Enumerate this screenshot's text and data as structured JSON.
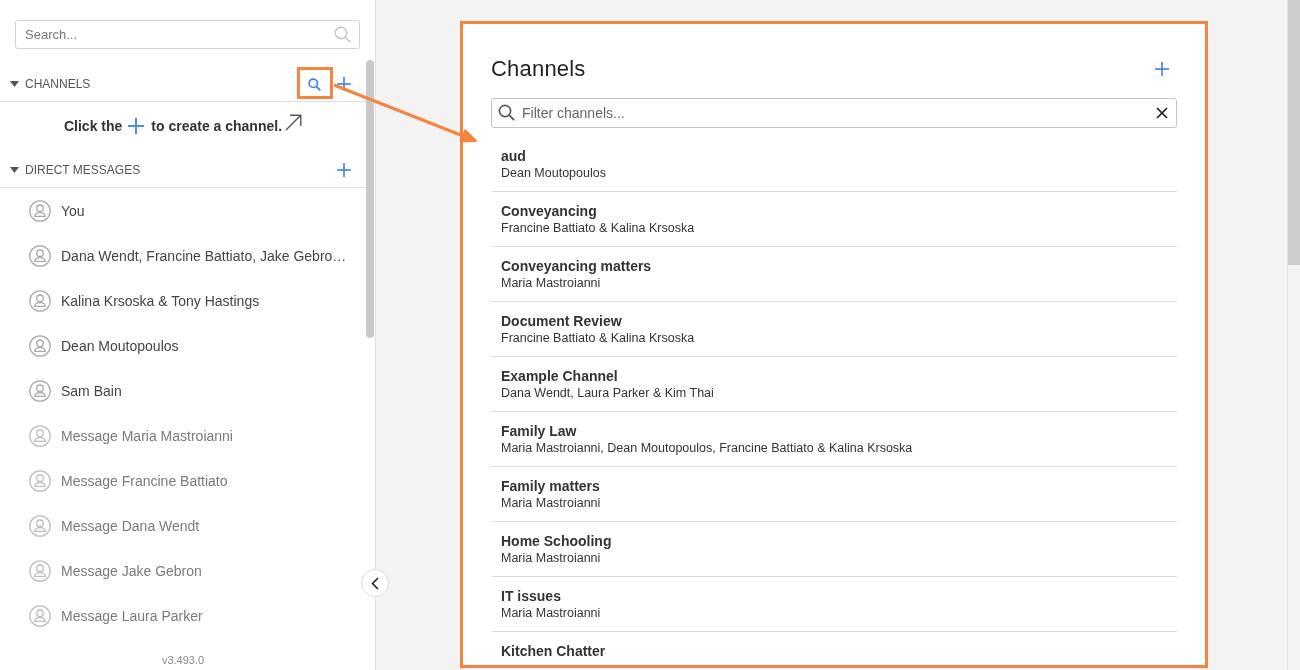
{
  "sidebar": {
    "search": {
      "placeholder": "Search..."
    },
    "channels": {
      "title": "CHANNELS",
      "expanded": true,
      "hint_before": "Click the",
      "hint_after": "to create a channel."
    },
    "direct_messages": {
      "title": "DIRECT MESSAGES",
      "expanded": true,
      "items": [
        {
          "label": "You",
          "kind": "conversation"
        },
        {
          "label": "Dana Wendt, Francine Battiato, Jake Gebro…",
          "kind": "conversation"
        },
        {
          "label": "Kalina Krsoska & Tony Hastings",
          "kind": "conversation"
        },
        {
          "label": "Dean Moutopoulos",
          "kind": "conversation"
        },
        {
          "label": "Sam Bain",
          "kind": "conversation"
        },
        {
          "label": "Message Maria Mastroianni",
          "kind": "suggestion"
        },
        {
          "label": "Message Francine Battiato",
          "kind": "suggestion"
        },
        {
          "label": "Message Dana Wendt",
          "kind": "suggestion"
        },
        {
          "label": "Message Jake Gebron",
          "kind": "suggestion"
        },
        {
          "label": "Message Laura Parker",
          "kind": "suggestion"
        }
      ]
    },
    "version": "v3.493.0"
  },
  "channels_panel": {
    "title": "Channels",
    "filter": {
      "placeholder": "Filter channels..."
    },
    "channels": [
      {
        "name": "aud",
        "members": "Dean Moutopoulos"
      },
      {
        "name": "Conveyancing",
        "members": "Francine Battiato & Kalina Krsoska"
      },
      {
        "name": "Conveyancing matters",
        "members": "Maria Mastroianni"
      },
      {
        "name": "Document Review",
        "members": "Francine Battiato & Kalina Krsoska"
      },
      {
        "name": "Example Channel",
        "members": "Dana Wendt, Laura Parker & Kim Thai"
      },
      {
        "name": "Family Law",
        "members": "Maria Mastroianni, Dean Moutopoulos, Francine Battiato & Kalina Krsoska"
      },
      {
        "name": "Family matters",
        "members": "Maria Mastroianni"
      },
      {
        "name": "Home Schooling",
        "members": "Maria Mastroianni"
      },
      {
        "name": "IT issues",
        "members": "Maria Mastroianni"
      },
      {
        "name": "Kitchen Chatter"
      }
    ]
  }
}
